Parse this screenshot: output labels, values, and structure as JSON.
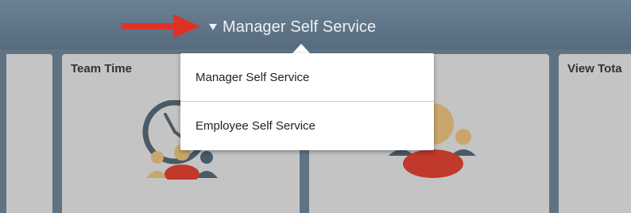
{
  "header": {
    "homepage_title": "Manager Self Service",
    "caret_icon": "triangle-down-icon",
    "arrow_annotation_icon": "red-arrow-right-icon"
  },
  "homepage_menu": {
    "items": [
      {
        "label": "Manager Self Service"
      },
      {
        "label": "Employee Self Service"
      }
    ]
  },
  "tiles": {
    "team_time": {
      "title": "Team Time",
      "icon": "clock-with-people-icon"
    },
    "middle": {
      "icon": "group-people-icon"
    },
    "view_total": {
      "title": "View Tota"
    }
  },
  "colors": {
    "header_bg": "#5f7384",
    "tile_bg": "#c4c4c4",
    "annotation_red": "#e03127",
    "people_red": "#c0392b",
    "people_tan": "#c9a66b",
    "people_dark": "#4a5a66"
  }
}
